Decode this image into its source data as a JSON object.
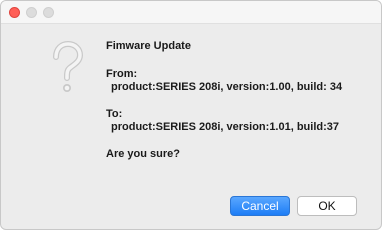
{
  "window": {
    "traffic_lights": {
      "close_color": "#ff5f57",
      "inactive_color": "#dcdcdc"
    }
  },
  "dialog": {
    "icon": "question-mark-icon",
    "title": "Fimware Update",
    "from_label": "From:",
    "from_value": "product:SERIES 208i, version:1.00, build: 34",
    "to_label": "To:",
    "to_value": "product:SERIES 208i, version:1.01, build:37",
    "question": "Are you sure?"
  },
  "buttons": {
    "cancel_label": "Cancel",
    "ok_label": "OK",
    "accent_color": "#1d7df6"
  }
}
